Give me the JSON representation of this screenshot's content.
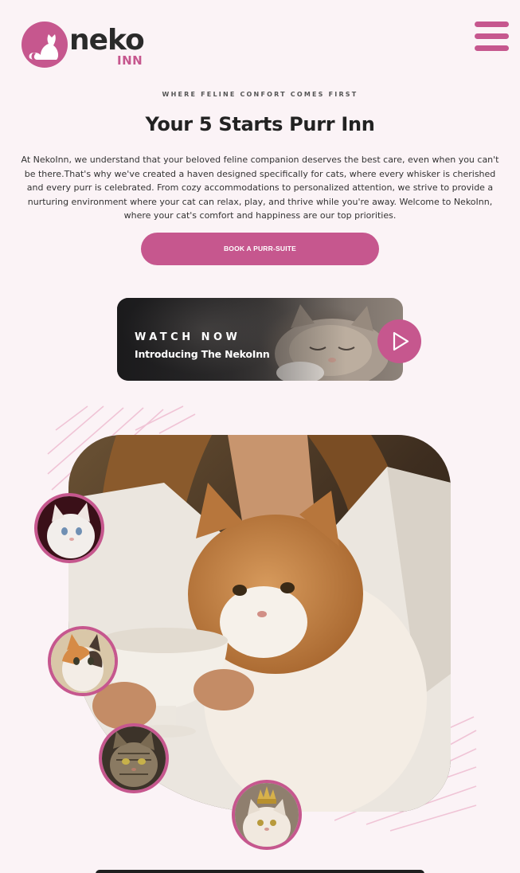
{
  "brand": {
    "name": "neko",
    "sub": "INN",
    "accent_color": "#c6578e",
    "logo_icon": "cat-silhouette-icon"
  },
  "nav": {
    "menu_icon": "hamburger-menu-icon"
  },
  "hero_text": {
    "eyebrow": "WHERE FELINE CONFORT COMES FIRST",
    "headline": "Your 5 Starts Purr Inn",
    "intro": "At NekoInn, we understand that your beloved feline companion deserves the best care, even when you can't be there.That's why we've created a haven designed specifically for cats, where every whisker is cherished and every purr is celebrated. From cozy accommodations to personalized attention, we strive to provide a nurturing environment where your cat can relax, play, and thrive while you're away. Welcome to NekoInn, where your cat's comfort and happiness are our top priorities.",
    "cta_label": "BOOK A PURR-SUITE"
  },
  "video": {
    "eyebrow": "WATCH NOW",
    "title": "Introducing The NekoInn",
    "play_icon": "play-icon"
  },
  "gallery": {
    "main_photo": "woman-holding-cat-photo",
    "thumbnails": [
      "white-kitten-photo",
      "calico-kitten-photo",
      "tabby-cat-photo",
      "crowned-cat-photo"
    ]
  }
}
